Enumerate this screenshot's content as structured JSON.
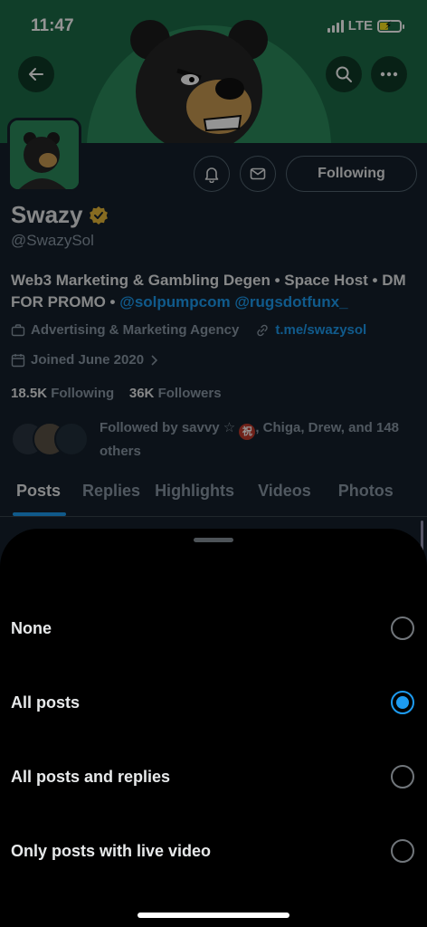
{
  "status_bar": {
    "time": "11:47",
    "network": "LTE"
  },
  "profile": {
    "name": "Swazy",
    "handle": "@SwazySol",
    "bio_text": "Web3 Marketing & Gambling Degen • Space Host • DM FOR PROMO •",
    "bio_mention_1": "@solpumpcom",
    "bio_mention_2": "@rugsdotfunx_",
    "category": "Advertising & Marketing Agency",
    "website": "t.me/swazysol",
    "joined": "Joined June 2020",
    "following_count": "18.5K",
    "following_label": "Following",
    "followers_count": "36K",
    "followers_label": "Followers",
    "followed_by_prefix": "Followed by savvy",
    "followed_by_suffix": ", Chiga, Drew, and 148 others",
    "following_button": "Following"
  },
  "tabs": [
    "Posts",
    "Replies",
    "Highlights",
    "Videos",
    "Photos"
  ],
  "sheet": {
    "options": [
      {
        "label": "None",
        "selected": false
      },
      {
        "label": "All posts",
        "selected": true
      },
      {
        "label": "All posts and replies",
        "selected": false
      },
      {
        "label": "Only posts with live video",
        "selected": false
      }
    ]
  },
  "colors": {
    "accent": "#1d9bf0",
    "background": "#15202b",
    "sheet": "#000000",
    "verified": "#e8b93a"
  },
  "icons": [
    "back-arrow-icon",
    "search-icon",
    "more-icon",
    "notification-bell-icon",
    "mail-icon",
    "verified-badge-icon",
    "briefcase-icon",
    "link-icon",
    "calendar-icon",
    "chevron-right-icon"
  ]
}
